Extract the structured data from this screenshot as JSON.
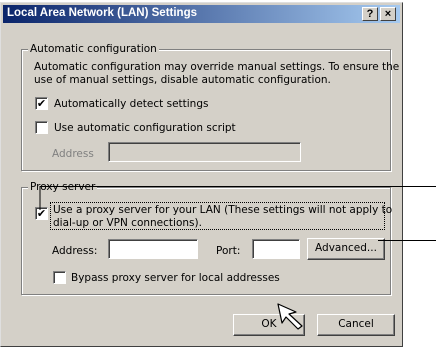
{
  "dialog": {
    "title": "Local Area Network (LAN) Settings",
    "help_button": "?",
    "close_button": "×"
  },
  "auto_config": {
    "legend": "Automatic configuration",
    "description_line1": "Automatic configuration may override manual settings.  To ensure the",
    "description_line2": "use of manual settings, disable automatic configuration.",
    "detect_label": "Automatically detect settings",
    "detect_checked": true,
    "script_label": "Use automatic configuration script",
    "script_checked": false,
    "address_label": "Address",
    "address_value": ""
  },
  "proxy": {
    "legend": "Proxy server",
    "use_proxy_line1": "Use a proxy server for your LAN (These settings will not apply to",
    "use_proxy_line2": "dial-up or VPN connections).",
    "use_proxy_checked": true,
    "address_label": "Address:",
    "address_value": "",
    "port_label": "Port:",
    "port_value": "",
    "advanced_button": "Advanced...",
    "bypass_label": "Bypass proxy server for local addresses",
    "bypass_checked": false
  },
  "footer": {
    "ok_button": "OK",
    "cancel_button": "Cancel"
  },
  "icons": {
    "check_glyph": "✔"
  }
}
